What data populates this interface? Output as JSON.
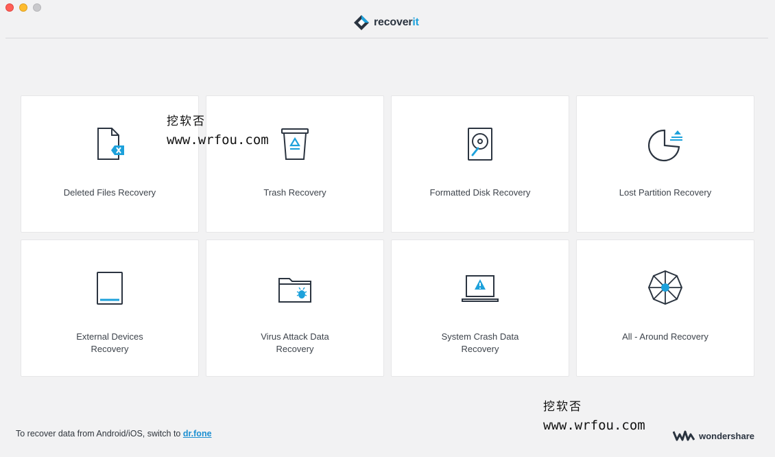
{
  "window": {
    "brand": {
      "name_main": "recover",
      "name_accent": "it"
    }
  },
  "cards": [
    {
      "id": "deleted-files",
      "label": "Deleted Files Recovery",
      "icon": "deleted-file-icon"
    },
    {
      "id": "trash",
      "label": "Trash Recovery",
      "icon": "trash-recycle-icon"
    },
    {
      "id": "formatted-disk",
      "label": "Formatted Disk Recovery",
      "icon": "hard-disk-icon"
    },
    {
      "id": "lost-partition",
      "label": "Lost Partition Recovery",
      "icon": "pie-partition-icon"
    },
    {
      "id": "external-devices",
      "label": "External Devices\nRecovery",
      "icon": "external-drive-icon"
    },
    {
      "id": "virus-attack",
      "label": "Virus Attack Data\nRecovery",
      "icon": "folder-bug-icon"
    },
    {
      "id": "system-crash",
      "label": "System Crash Data\nRecovery",
      "icon": "laptop-warning-icon"
    },
    {
      "id": "all-around",
      "label": "All - Around Recovery",
      "icon": "all-around-wheel-icon"
    }
  ],
  "watermarks": [
    {
      "cn": "挖软否",
      "url": "www.wrfou.com"
    },
    {
      "cn": "挖软否",
      "url": "www.wrfou.com"
    }
  ],
  "footer": {
    "note_prefix": "To recover data from Android/iOS, switch to ",
    "link_label": "dr.fone",
    "company": "wondershare"
  },
  "colors": {
    "accent": "#1da1db",
    "icon_stroke": "#2b3440",
    "background": "#f2f2f3"
  }
}
